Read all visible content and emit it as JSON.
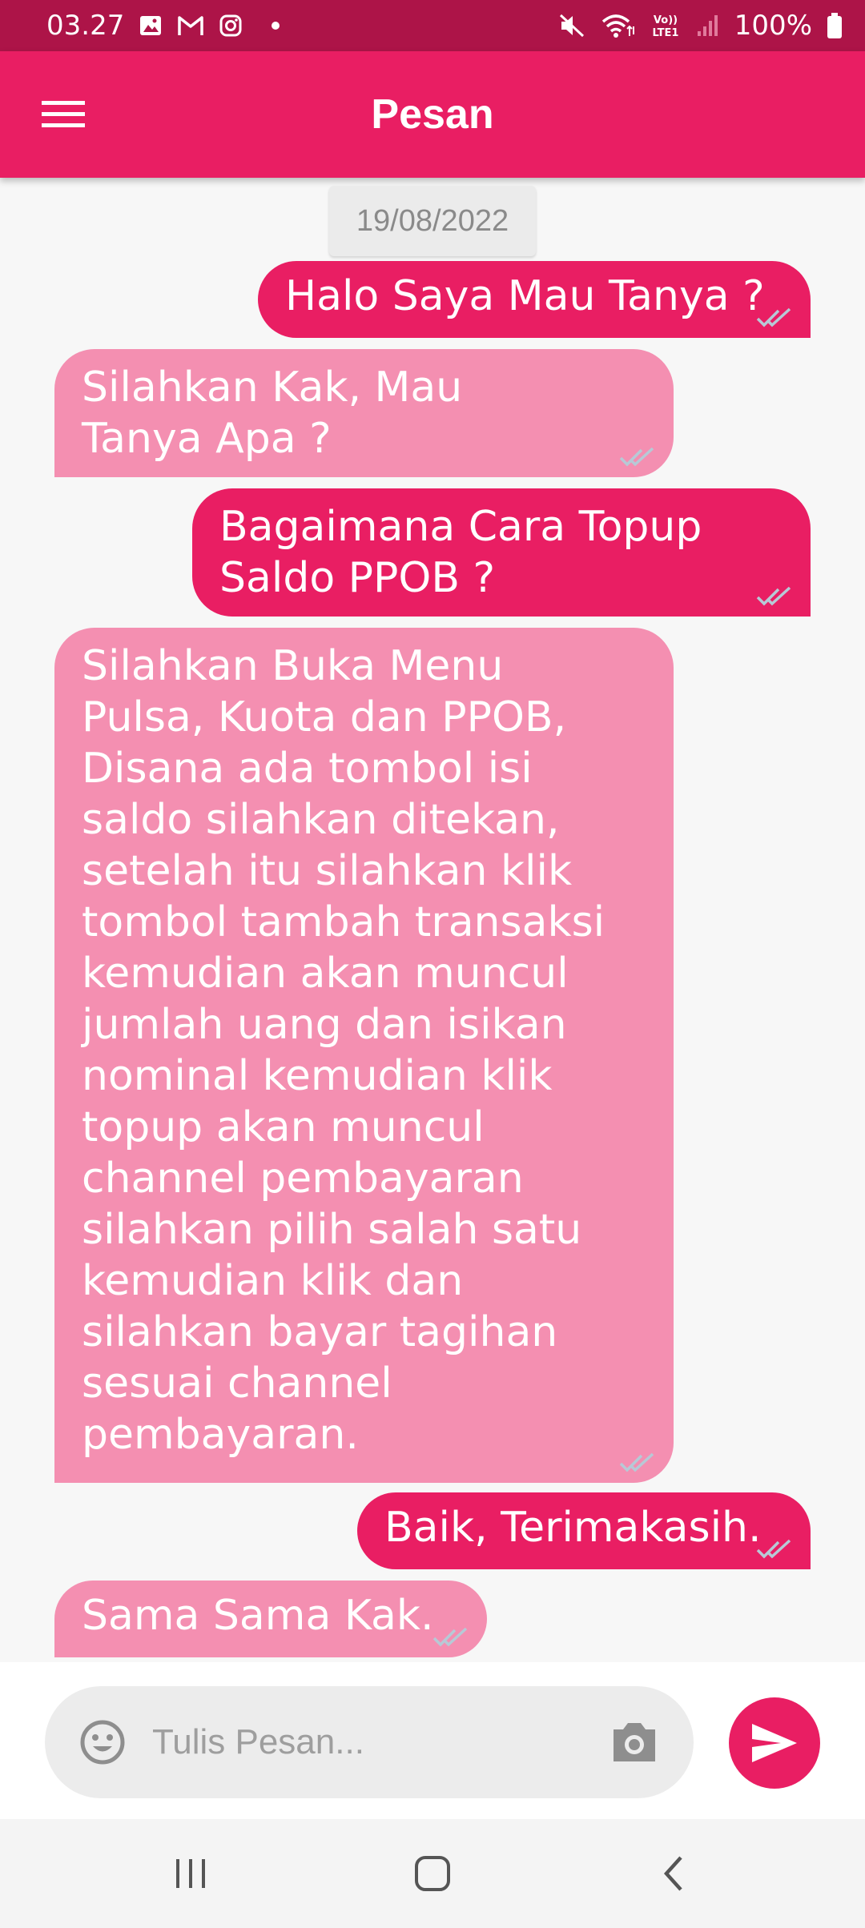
{
  "status_bar": {
    "time": "03.27",
    "battery": "100%",
    "icons": [
      "gallery-icon",
      "gmail-icon",
      "instagram-icon",
      "dot-icon",
      "mute-icon",
      "wifi-icon",
      "volte-icon",
      "signal-icon",
      "battery-icon"
    ],
    "volte_label": "Vo)) LTE1"
  },
  "app_bar": {
    "title": "Pesan",
    "menu_icon": "hamburger-icon"
  },
  "chat": {
    "date": "19/08/2022",
    "messages": [
      {
        "direction": "out",
        "text": "Halo Saya Mau Tanya ?",
        "status": "read"
      },
      {
        "direction": "in",
        "text": "Silahkan Kak, Mau Tanya Apa ?",
        "status": "read"
      },
      {
        "direction": "out",
        "text": "Bagaimana Cara Topup Saldo PPOB ?",
        "status": "read"
      },
      {
        "direction": "in",
        "text": "Silahkan Buka Menu Pulsa, Kuota dan PPOB, Disana ada tombol isi saldo silahkan ditekan, setelah itu silahkan klik tombol tambah transaksi kemudian akan muncul jumlah uang dan isikan nominal kemudian klik topup akan muncul channel pembayaran silahkan pilih salah satu kemudian klik dan silahkan bayar tagihan sesuai channel pembayaran.",
        "status": "read"
      },
      {
        "direction": "out",
        "text": "Baik, Terimakasih.",
        "status": "read"
      },
      {
        "direction": "in",
        "text": "Sama Sama Kak.",
        "status": "read"
      }
    ]
  },
  "composer": {
    "placeholder": "Tulis Pesan...",
    "emoji_icon": "emoji-icon",
    "camera_icon": "camera-icon",
    "send_icon": "send-icon"
  },
  "nav_bar": {
    "buttons": [
      "recents-icon",
      "home-icon",
      "back-icon"
    ]
  },
  "colors": {
    "status_bar": "#ad1448",
    "primary": "#e91e63",
    "incoming_bubble": "#f48fb1",
    "background": "#f7f7f7"
  }
}
